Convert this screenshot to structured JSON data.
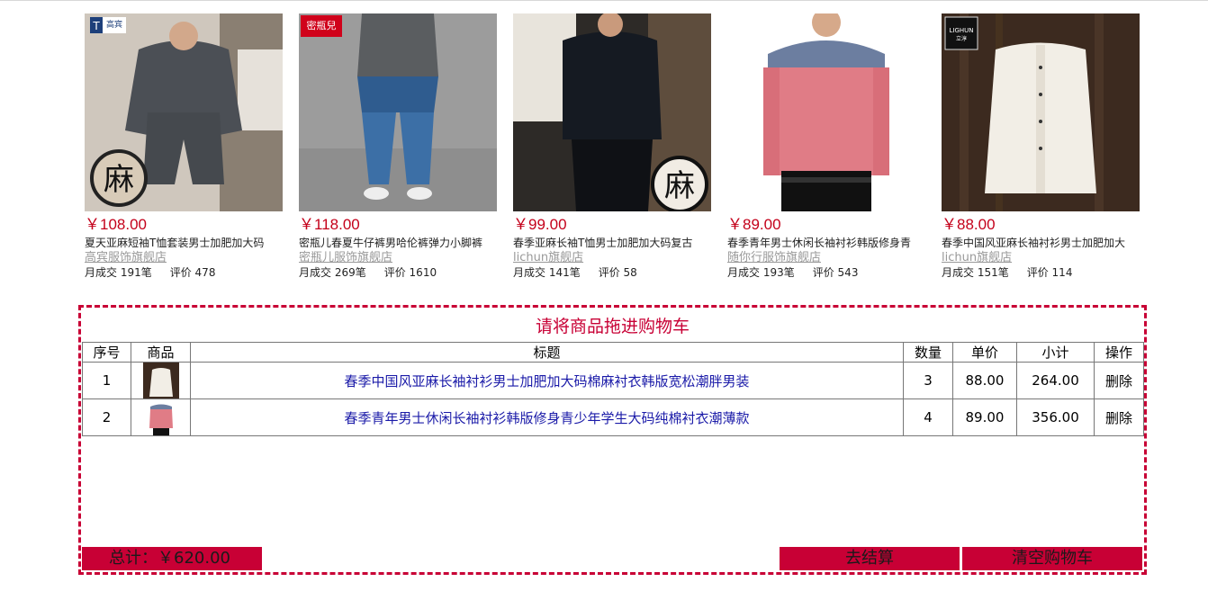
{
  "products": [
    {
      "price": "￥108.00",
      "title": "夏天亚麻短袖T恤套装男士加肥加大码",
      "shop": "高宾服饰旗舰店",
      "sales": "月成交 191笔",
      "reviews": "评价 478",
      "brand_logo": "高宾"
    },
    {
      "price": "￥118.00",
      "title": "密瓶儿春夏牛仔裤男哈伦裤弹力小脚裤",
      "shop": "密瓶儿服饰旗舰店",
      "sales": "月成交 269笔",
      "reviews": "评价 1610",
      "brand_logo": "密瓶兒"
    },
    {
      "price": "￥99.00",
      "title": "春季亚麻长袖T恤男士加肥加大码复古",
      "shop": "lichun旗舰店",
      "sales": "月成交 141笔",
      "reviews": "评价 58",
      "brand_logo": ""
    },
    {
      "price": "￥89.00",
      "title": "春季青年男士休闲长袖衬衫韩版修身青",
      "shop": "随你行服饰旗舰店",
      "sales": "月成交 193笔",
      "reviews": "评价 543",
      "brand_logo": ""
    },
    {
      "price": "￥88.00",
      "title": "春季中国风亚麻长袖衬衫男士加肥加大",
      "shop": "lichun旗舰店",
      "sales": "月成交 151笔",
      "reviews": "评价 114",
      "brand_logo": "LIGHUN"
    }
  ],
  "cart": {
    "heading": "请将商品拖进购物车",
    "columns": [
      "序号",
      "商品",
      "标题",
      "数量",
      "单价",
      "小计",
      "操作"
    ],
    "rows": [
      {
        "index": "1",
        "title": "春季中国风亚麻长袖衬衫男士加肥加大码棉麻衬衣韩版宽松潮胖男装",
        "qty": "3",
        "unit_price": "88.00",
        "subtotal": "264.00",
        "action": "删除"
      },
      {
        "index": "2",
        "title": "春季青年男士休闲长袖衬衫韩版修身青少年学生大码纯棉衬衣潮薄款",
        "qty": "4",
        "unit_price": "89.00",
        "subtotal": "356.00",
        "action": "删除"
      }
    ],
    "total_label": "总计：￥620.00",
    "checkout_label": "去结算",
    "clear_label": "清空购物车"
  },
  "colors": {
    "accent": "#c80035",
    "price": "#c4001a",
    "link_title": "#1a1aa8"
  }
}
